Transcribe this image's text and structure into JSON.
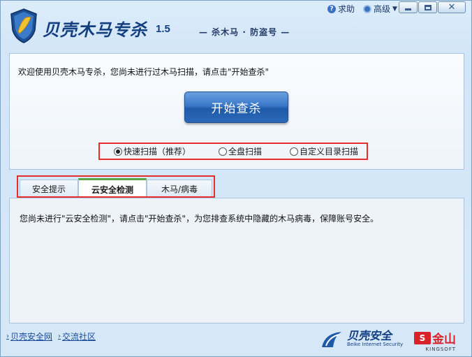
{
  "titlebar": {
    "app_name": "贝壳木马专杀",
    "version": "1.5",
    "slogan": "— 杀木马 · 防盗号 —",
    "help_label": "求助",
    "advanced_label": "高级"
  },
  "scan_panel": {
    "welcome_text": "欢迎使用贝壳木马专杀，您尚未进行过木马扫描，请点击\"开始查杀\"",
    "start_button_label": "开始查杀",
    "scan_options": [
      {
        "label": "快速扫描（推荐）",
        "selected": true
      },
      {
        "label": "全盘扫描",
        "selected": false
      },
      {
        "label": "自定义目录扫描",
        "selected": false
      }
    ]
  },
  "tabs": [
    {
      "label": "安全提示",
      "active": false
    },
    {
      "label": "云安全检测",
      "active": true
    },
    {
      "label": "木马/病毒",
      "active": false
    }
  ],
  "tab_content": {
    "message": "您尚未进行\"云安全检测\"，请点击\"开始查杀\"，为您排查系统中隐藏的木马病毒，保障账号安全。"
  },
  "footer": {
    "links": [
      "贝壳安全网",
      "交流社区"
    ],
    "beike_logo_text": "贝壳安全",
    "beike_logo_sub": "Beike Internet Security",
    "kingsoft_logo_text": "金山",
    "kingsoft_logo_sub": "KINGSOFT"
  },
  "colors": {
    "accent_blue": "#123e82",
    "button_blue": "#2b69b8",
    "highlight_red": "#e52d2d",
    "active_tab_green": "#5aa448",
    "kingsoft_red": "#d8232a"
  }
}
